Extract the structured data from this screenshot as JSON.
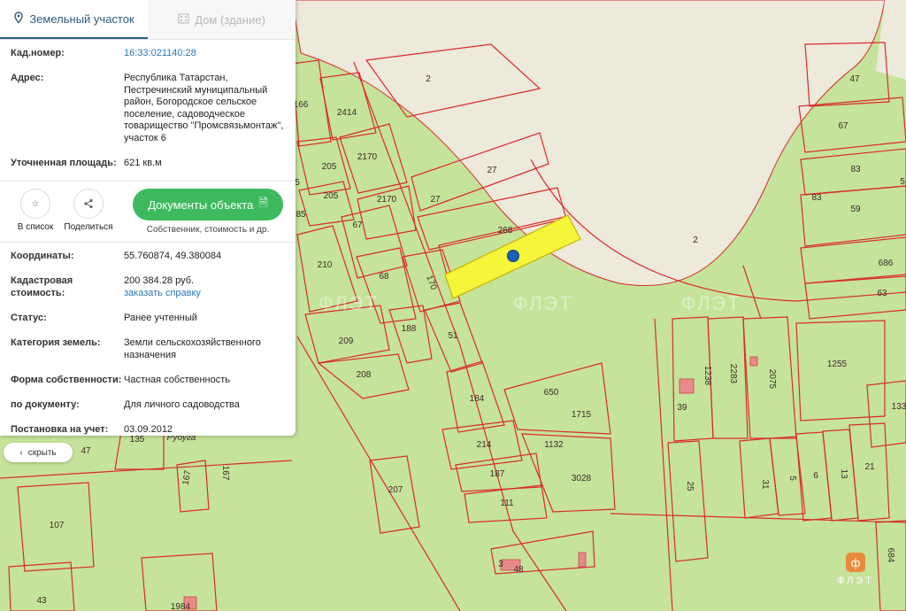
{
  "tabs": [
    {
      "label": "Земельный участок",
      "icon": "map-pin-icon",
      "active": true
    },
    {
      "label": "Дом (здание)",
      "icon": "building-icon",
      "active": false
    }
  ],
  "fields_top": [
    {
      "label": "Кад.номер:",
      "value": "16:33:021140:28",
      "link": true
    },
    {
      "label": "Адрес:",
      "value": "Республика Татарстан, Пестречинский муниципальный район, Богородское сельское поселение, садоводческое товарищество \"Промсвязьмонтаж\", участок 6",
      "link": false
    },
    {
      "label": "Уточненная площадь:",
      "value": "621 кв.м",
      "link": false
    }
  ],
  "actions": {
    "favorite_label": "В список",
    "share_label": "Поделиться",
    "documents_label": "Документы объекта",
    "documents_sub": "Собственник, стоимость и др."
  },
  "fields_bottom": [
    {
      "label": "Координаты:",
      "value": "55.760874, 49.380084"
    },
    {
      "label": "Кадастровая стоимость:",
      "value": "200 384.28 руб.",
      "extra_link": "заказать справку"
    },
    {
      "label": "Статус:",
      "value": "Ранее учтенный"
    },
    {
      "label": "Категория земель:",
      "value": "Земли сельскохозяйственного назначения"
    },
    {
      "label": "Форма собственности:",
      "value": "Частная собственность"
    },
    {
      "label": "по документу:",
      "value": "Для личного садоводства"
    },
    {
      "label": "Постановка на учет:",
      "value": "03.09.2012"
    }
  ],
  "hide_button": "скрыть",
  "watermark": "ФЛЭТ",
  "logo_text": "ФЛЭТ",
  "colors": {
    "land": "#c5e39a",
    "road": "#ede9db",
    "boundary": "#d92b2b",
    "selected": "#f5f53a",
    "marker": "#1b5fb8",
    "button": "#3dba5e"
  },
  "map_labels": [
    "2",
    "2414",
    "166",
    "205",
    "2170",
    "27",
    "27",
    "268",
    "2",
    "205",
    "2170",
    "5",
    "85",
    "67",
    "210",
    "68",
    "170",
    "209",
    "188",
    "51",
    "208",
    "184",
    "650",
    "1715",
    "214",
    "1132",
    "187",
    "3028",
    "207",
    "111",
    "3",
    "48",
    "135",
    "47",
    "167",
    "167",
    "107",
    "43",
    "1984",
    "47",
    "67",
    "83",
    "83",
    "59",
    "5",
    "686",
    "63",
    "1255",
    "1238",
    "2283",
    "2075",
    "39",
    "25",
    "133",
    "31",
    "5",
    "6",
    "13",
    "21",
    "684",
    "Рубуга"
  ]
}
